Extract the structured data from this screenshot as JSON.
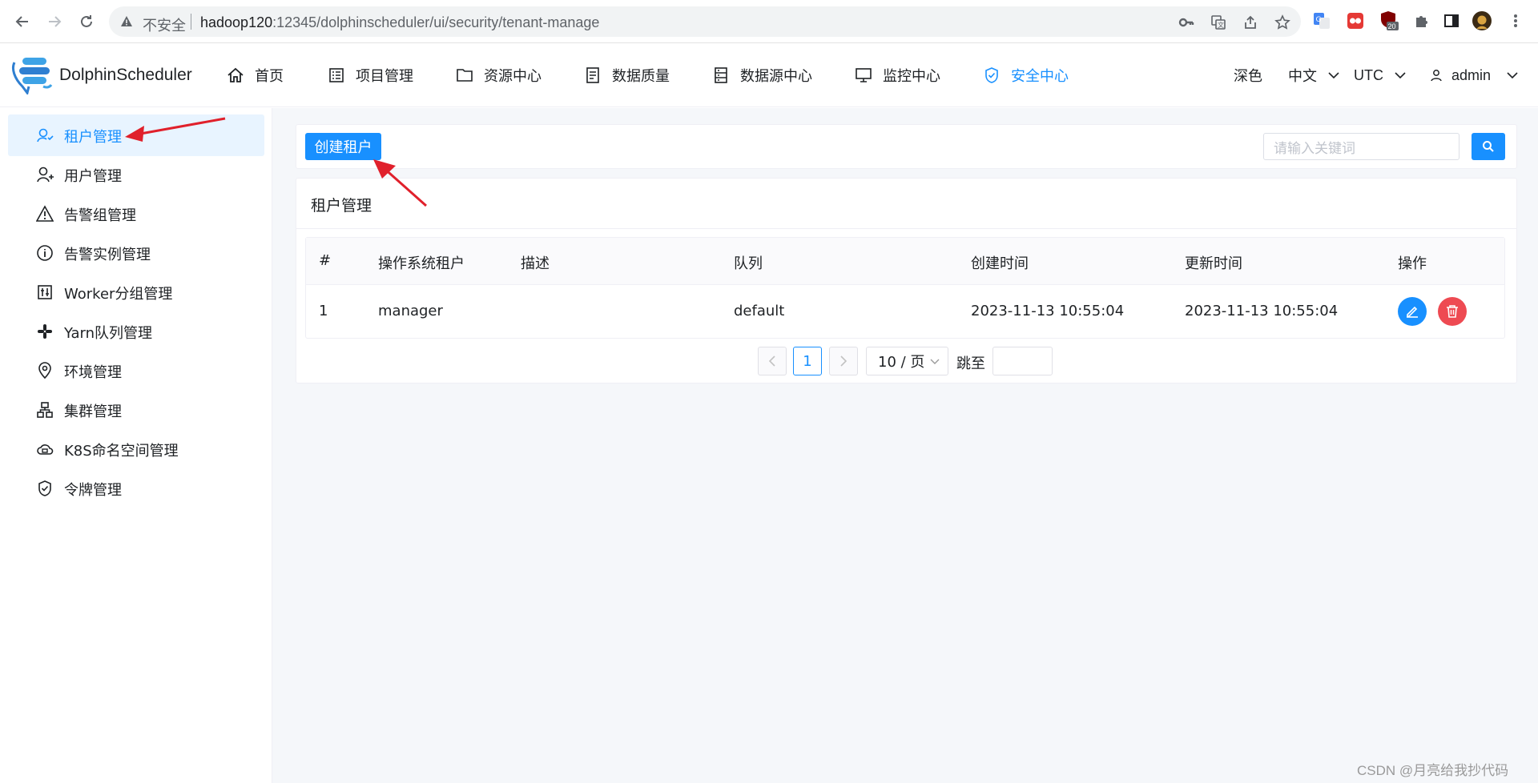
{
  "browser": {
    "insecure_label": "不安全",
    "url_host": "hadoop120",
    "url_rest": ":12345/dolphinscheduler/ui/security/tenant-manage",
    "extension_badge": "20"
  },
  "header": {
    "logo_text": "DolphinScheduler",
    "menu": [
      {
        "label": "首页",
        "icon": "home-icon"
      },
      {
        "label": "项目管理",
        "icon": "project-icon"
      },
      {
        "label": "资源中心",
        "icon": "folder-icon"
      },
      {
        "label": "数据质量",
        "icon": "data-quality-icon"
      },
      {
        "label": "数据源中心",
        "icon": "datasource-icon"
      },
      {
        "label": "监控中心",
        "icon": "monitor-icon"
      },
      {
        "label": "安全中心",
        "icon": "shield-icon"
      }
    ],
    "theme": "深色",
    "language": "中文",
    "timezone": "UTC",
    "user": "admin"
  },
  "sidebar": {
    "items": [
      {
        "label": "租户管理",
        "icon": "tenant-icon"
      },
      {
        "label": "用户管理",
        "icon": "user-icon"
      },
      {
        "label": "告警组管理",
        "icon": "warning-icon"
      },
      {
        "label": "告警实例管理",
        "icon": "info-icon"
      },
      {
        "label": "Worker分组管理",
        "icon": "worker-icon"
      },
      {
        "label": "Yarn队列管理",
        "icon": "slack-icon"
      },
      {
        "label": "环境管理",
        "icon": "location-icon"
      },
      {
        "label": "集群管理",
        "icon": "cluster-icon"
      },
      {
        "label": "K8S命名空间管理",
        "icon": "cloud-icon"
      },
      {
        "label": "令牌管理",
        "icon": "token-icon"
      }
    ]
  },
  "toolbar": {
    "create_label": "创建租户",
    "search_placeholder": "请输入关键词"
  },
  "card": {
    "title": "租户管理"
  },
  "table": {
    "columns": [
      "#",
      "操作系统租户",
      "描述",
      "队列",
      "创建时间",
      "更新时间",
      "操作"
    ],
    "rows": [
      {
        "index": "1",
        "tenant": "manager",
        "description": "",
        "queue": "default",
        "created": "2023-11-13 10:55:04",
        "updated": "2023-11-13 10:55:04"
      }
    ]
  },
  "pagination": {
    "current_page": "1",
    "page_size": "10 / 页",
    "jump_label": "跳至"
  },
  "watermark": "CSDN @月亮给我抄代码",
  "colors": {
    "primary": "#1890ff",
    "danger": "#ee4a52",
    "active_bg": "#e8f4ff",
    "annotation_arrow": "#e0202b"
  }
}
